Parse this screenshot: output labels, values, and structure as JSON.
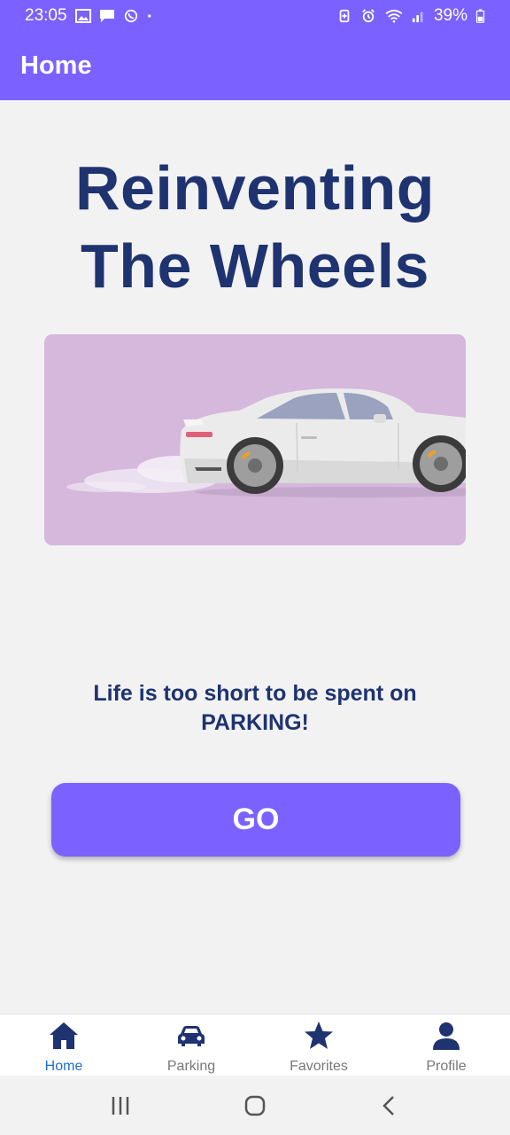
{
  "status_bar": {
    "time": "23:05",
    "battery": "39%",
    "icons_left": [
      "gallery-icon",
      "message-icon",
      "whatsapp-icon",
      "dot-icon"
    ],
    "icons_right": [
      "battery-saver-icon",
      "alarm-icon",
      "wifi-icon",
      "signal-icon",
      "battery-icon"
    ]
  },
  "app_bar": {
    "title": "Home"
  },
  "hero": {
    "title_line1": "Reinventing",
    "title_line2": "The Wheels",
    "image": "white-sports-car-illustration",
    "image_bg": "#d5b8dc"
  },
  "tagline": {
    "line1": "Life is too short to be spent on",
    "line2": "PARKING!"
  },
  "go_button": {
    "label": "GO"
  },
  "bottom_nav": {
    "items": [
      {
        "label": "Home",
        "icon": "home-icon",
        "active": true
      },
      {
        "label": "Parking",
        "icon": "car-icon",
        "active": false
      },
      {
        "label": "Favorites",
        "icon": "star-icon",
        "active": false
      },
      {
        "label": "Profile",
        "icon": "person-icon",
        "active": false
      }
    ]
  },
  "colors": {
    "accent": "#7b61ff",
    "title_text": "#1e3370",
    "nav_active": "#1b6fd1",
    "background": "#f2f2f2"
  }
}
